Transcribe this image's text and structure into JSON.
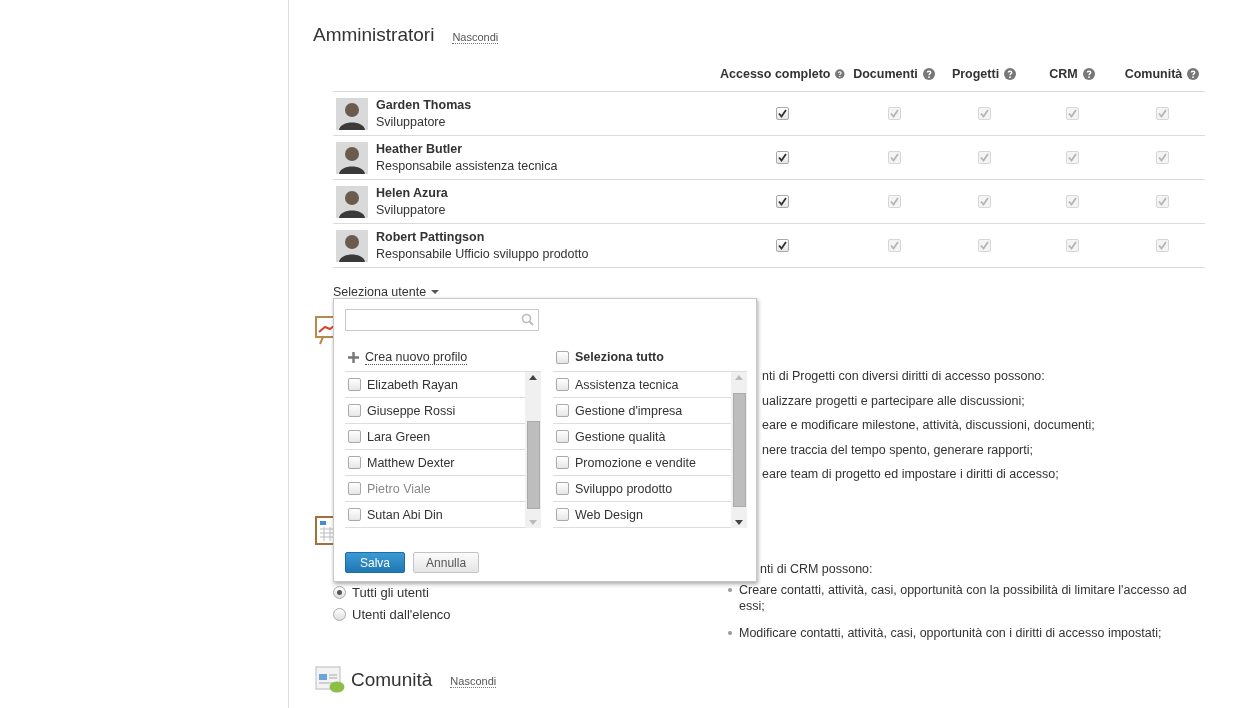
{
  "admins": {
    "title": "Amministratori",
    "hide_link": "Nascondi"
  },
  "table": {
    "columns": [
      {
        "label": "Accesso completo"
      },
      {
        "label": "Documenti"
      },
      {
        "label": "Progetti"
      },
      {
        "label": "CRM"
      },
      {
        "label": "Comunità"
      }
    ],
    "rows": [
      {
        "name": "Garden Thomas",
        "role": "Sviluppatore",
        "cells": [
          {
            "checked": true,
            "disabled": false
          },
          {
            "checked": true,
            "disabled": true
          },
          {
            "checked": true,
            "disabled": true
          },
          {
            "checked": true,
            "disabled": true
          },
          {
            "checked": true,
            "disabled": true
          }
        ]
      },
      {
        "name": "Heather Butler",
        "role": "Responsabile assistenza tecnica",
        "cells": [
          {
            "checked": true,
            "disabled": false
          },
          {
            "checked": true,
            "disabled": true
          },
          {
            "checked": true,
            "disabled": true
          },
          {
            "checked": true,
            "disabled": true
          },
          {
            "checked": true,
            "disabled": true
          }
        ]
      },
      {
        "name": "Helen Azura",
        "role": "Sviluppatore",
        "cells": [
          {
            "checked": true,
            "disabled": false
          },
          {
            "checked": true,
            "disabled": true
          },
          {
            "checked": true,
            "disabled": true
          },
          {
            "checked": true,
            "disabled": true
          },
          {
            "checked": true,
            "disabled": true
          }
        ]
      },
      {
        "name": "Robert Pattingson",
        "role": "Responsabile Ufficio sviluppo prodotto",
        "cells": [
          {
            "checked": true,
            "disabled": false
          },
          {
            "checked": true,
            "disabled": true
          },
          {
            "checked": true,
            "disabled": true
          },
          {
            "checked": true,
            "disabled": true
          },
          {
            "checked": true,
            "disabled": true
          }
        ]
      }
    ]
  },
  "select_user": {
    "label": "Seleziona utente"
  },
  "projects": {
    "lines": [
      "nti di Progetti con diversi diritti di accesso possono:",
      "ualizzare progetti e partecipare alle discussioni;",
      "eare e modificare milestone, attività, discussioni, documenti;",
      "nere traccia del tempo spento, generare rapporti;",
      "eare team di progetto ed impostare i diritti di accesso;"
    ]
  },
  "crm": {
    "radios": [
      {
        "label": "Tutti gli utenti",
        "selected": true
      },
      {
        "label": "Utenti dall'elenco",
        "selected": false
      }
    ],
    "intro": "nti di CRM possono:",
    "bullets": [
      "Creare contatti, attività, casi, opportunità con la possibilità di limitare l'accesso ad essi;",
      "Modificare contatti, attività, casi, opportunità con i diritti di accesso impostati;"
    ]
  },
  "community": {
    "title": "Comunità",
    "hide_link": "Nascondi"
  },
  "popup": {
    "create_profile": "Crea nuovo profilo",
    "select_all": {
      "label": "Seleziona tutto",
      "checked": false
    },
    "users": [
      {
        "label": "Elizabeth Rayan",
        "checked": false,
        "disabled": false
      },
      {
        "label": "Giuseppe Rossi",
        "checked": false,
        "disabled": false
      },
      {
        "label": "Lara Green",
        "checked": false,
        "disabled": false
      },
      {
        "label": "Matthew Dexter",
        "checked": false,
        "disabled": false
      },
      {
        "label": "Pietro Viale",
        "checked": false,
        "disabled": true
      },
      {
        "label": "Sutan Abi Din",
        "checked": false,
        "disabled": false
      }
    ],
    "groups": [
      {
        "label": "Assistenza tecnica",
        "checked": false
      },
      {
        "label": "Gestione d'impresa",
        "checked": false
      },
      {
        "label": "Gestione qualità",
        "checked": false
      },
      {
        "label": "Promozione e vendite",
        "checked": false
      },
      {
        "label": "Sviluppo prodotto",
        "checked": false
      },
      {
        "label": "Web Design",
        "checked": false
      }
    ],
    "buttons": [
      {
        "label": "Salva",
        "kind": "primary"
      },
      {
        "label": "Annulla",
        "kind": "secondary"
      }
    ]
  }
}
